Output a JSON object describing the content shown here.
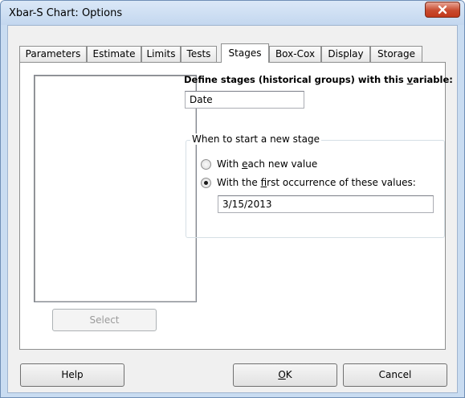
{
  "window": {
    "title": "Xbar-S Chart: Options"
  },
  "tabs": [
    {
      "label": "Parameters",
      "active": false
    },
    {
      "label": "Estimate",
      "active": false
    },
    {
      "label": "Limits",
      "active": false
    },
    {
      "label": "Tests",
      "active": false
    },
    {
      "label": "Stages",
      "active": true
    },
    {
      "label": "Box-Cox",
      "active": false
    },
    {
      "label": "Display",
      "active": false
    },
    {
      "label": "Storage",
      "active": false
    }
  ],
  "stages": {
    "variable_list_items": [],
    "select_button": "Select",
    "define_label": {
      "before": "Define stages (historical groups) with this ",
      "key": "v",
      "after": "ariable:"
    },
    "define_value": "Date",
    "group_title": "When to start a new stage",
    "option_each": {
      "before": "With ",
      "key": "e",
      "after": "ach new value",
      "checked": false
    },
    "option_first": {
      "before": "With the ",
      "key": "f",
      "after": "irst occurrence of these values:",
      "checked": true
    },
    "first_values": "3/15/2013"
  },
  "footer": {
    "help": "Help",
    "ok": {
      "key": "O",
      "after": "K"
    },
    "cancel": "Cancel"
  },
  "colors": {
    "close_button": "#c84b2f",
    "window_frame": "#c9dcf1"
  }
}
